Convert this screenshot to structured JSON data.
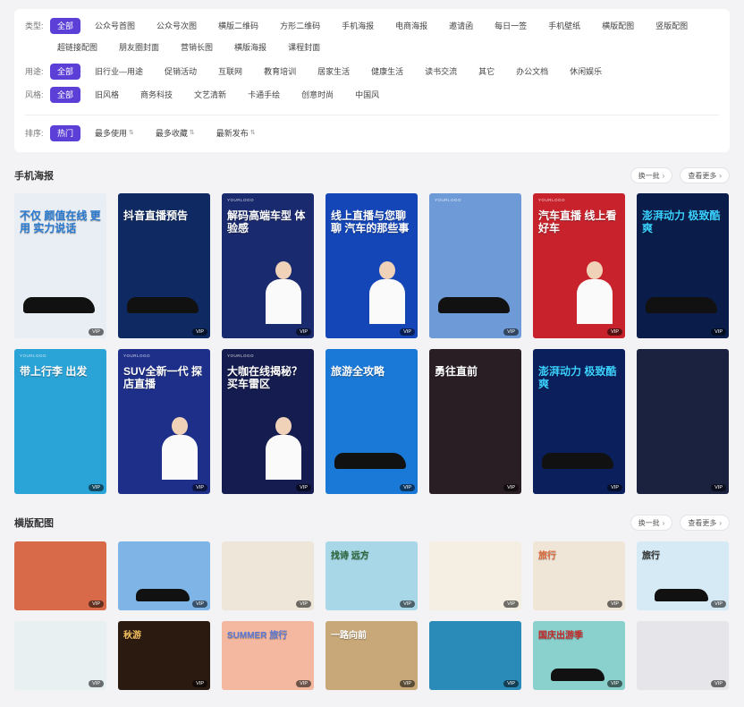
{
  "filters": {
    "type": {
      "label": "类型:",
      "items": [
        "全部",
        "公众号首图",
        "公众号次图",
        "横版二维码",
        "方形二维码",
        "手机海报",
        "电商海报",
        "邀请函",
        "每日一签",
        "手机壁纸",
        "横版配图",
        "竖版配图",
        "超链接配图",
        "朋友圈封面",
        "营销长图",
        "横版海报",
        "课程封面"
      ],
      "active": 0
    },
    "usage": {
      "label": "用途:",
      "items": [
        "全部",
        "旧行业—用途",
        "促销活动",
        "互联网",
        "教育培训",
        "居家生活",
        "健康生活",
        "读书交流",
        "其它",
        "办公文档",
        "休闲娱乐"
      ],
      "active": 0
    },
    "style": {
      "label": "风格:",
      "items": [
        "全部",
        "旧风格",
        "商务科技",
        "文艺清新",
        "卡通手绘",
        "创意时尚",
        "中国风"
      ],
      "active": 0
    },
    "sort": {
      "label": "排序:",
      "items": [
        "热门",
        "最多使用",
        "最多收藏",
        "最新发布"
      ],
      "active": 0,
      "icon": "sort-icon"
    }
  },
  "sections": [
    {
      "title": "手机海报",
      "refresh_label": "换一批",
      "more_label": "查看更多",
      "cards": [
        {
          "headline": "不仅 颜值在线 更用 实力说话",
          "bg": "#e8eef4",
          "text_color": "#2a7bd1",
          "logo": "",
          "shape": "car",
          "vip": "VIP"
        },
        {
          "headline": "抖音直播预告",
          "bg": "#0f2a63",
          "text_color": "#fff",
          "logo": "",
          "shape": "car",
          "vip": "VIP"
        },
        {
          "headline": "解码高端车型 体验感",
          "bg": "#1a2a6e",
          "text_color": "#fff",
          "logo": "YOURLOGO",
          "shape": "person",
          "vip": "VIP"
        },
        {
          "headline": "线上直播与您聊聊 汽车的那些事",
          "bg": "#1546b8",
          "text_color": "#fff",
          "logo": "",
          "shape": "person",
          "vip": "VIP"
        },
        {
          "headline": "",
          "bg": "#6e9bd8",
          "text_color": "#fff",
          "logo": "YOURLOGO",
          "shape": "car",
          "vip": "VIP"
        },
        {
          "headline": "汽车直播 线上看好车",
          "bg": "#c8232c",
          "text_color": "#fff",
          "logo": "YOURLOGO",
          "shape": "person",
          "vip": "VIP"
        },
        {
          "headline": "澎湃动力 极致酷爽",
          "bg": "#0a1c4a",
          "text_color": "#3ad0ff",
          "logo": "",
          "shape": "car",
          "vip": "VIP"
        },
        {
          "headline": "带上行李 出发",
          "bg": "#2aa3d6",
          "text_color": "#fff",
          "logo": "YOURLOGO",
          "shape": "none",
          "vip": "VIP"
        },
        {
          "headline": "SUV全新一代 探店直播",
          "bg": "#1e2f8a",
          "text_color": "#fff",
          "logo": "YOURLOGO",
          "shape": "person",
          "vip": "VIP"
        },
        {
          "headline": "大咖在线揭秘？ 买车雷区",
          "bg": "#151c4f",
          "text_color": "#fff",
          "logo": "YOURLOGO",
          "shape": "person",
          "vip": "VIP"
        },
        {
          "headline": "旅游全攻略",
          "bg": "#1a78d6",
          "text_color": "#fff",
          "logo": "",
          "shape": "car",
          "vip": "VIP"
        },
        {
          "headline": "勇往直前",
          "bg": "#2a1e25",
          "text_color": "#fff",
          "logo": "",
          "shape": "none",
          "vip": "VIP"
        },
        {
          "headline": "澎湃动力 极致酷爽",
          "bg": "#0b1f5c",
          "text_color": "#3ad0ff",
          "logo": "",
          "shape": "car",
          "vip": "VIP"
        },
        {
          "headline": "",
          "bg": "#1a2240",
          "text_color": "#fff",
          "logo": "",
          "shape": "none",
          "vip": "VIP"
        }
      ]
    },
    {
      "title": "横版配图",
      "refresh_label": "换一批",
      "more_label": "查看更多",
      "cards": [
        {
          "headline": "",
          "bg": "#d86a4a",
          "text_color": "#fff",
          "logo": "",
          "shape": "none",
          "vip": "VIP"
        },
        {
          "headline": "",
          "bg": "#7fb4e6",
          "text_color": "#fff",
          "logo": "",
          "shape": "car",
          "vip": "VIP"
        },
        {
          "headline": "",
          "bg": "#efe6da",
          "text_color": "#333",
          "logo": "",
          "shape": "none",
          "vip": "VIP"
        },
        {
          "headline": "找诗 远方",
          "bg": "#a8d8e8",
          "text_color": "#2a6a3a",
          "logo": "",
          "shape": "none",
          "vip": "VIP"
        },
        {
          "headline": "",
          "bg": "#f4efe2",
          "text_color": "#333",
          "logo": "",
          "shape": "none",
          "vip": "VIP"
        },
        {
          "headline": "旅行",
          "bg": "#f0e6d8",
          "text_color": "#e06a3a",
          "logo": "",
          "shape": "none",
          "vip": "VIP"
        },
        {
          "headline": "旅行",
          "bg": "#d6eaf6",
          "text_color": "#333",
          "logo": "",
          "shape": "car",
          "vip": "VIP"
        },
        {
          "headline": "",
          "bg": "#e8f0f2",
          "text_color": "#333",
          "logo": "",
          "shape": "none",
          "vip": "VIP"
        },
        {
          "headline": "秋游",
          "bg": "#2a1a10",
          "text_color": "#f4c060",
          "logo": "",
          "shape": "none",
          "vip": "VIP"
        },
        {
          "headline": "SUMMER 旅行",
          "bg": "#f4b8a0",
          "text_color": "#5a7ad6",
          "logo": "",
          "shape": "none",
          "vip": "VIP"
        },
        {
          "headline": "一路向前",
          "bg": "#c8a878",
          "text_color": "#fff",
          "logo": "",
          "shape": "none",
          "vip": "VIP"
        },
        {
          "headline": "",
          "bg": "#2a8ab8",
          "text_color": "#fff",
          "logo": "",
          "shape": "none",
          "vip": "VIP"
        },
        {
          "headline": "国庆出游季",
          "bg": "#8ad0cc",
          "text_color": "#c82a2a",
          "logo": "",
          "shape": "car",
          "vip": "VIP"
        },
        {
          "headline": "",
          "bg": "#e6e6ea",
          "text_color": "#333",
          "logo": "",
          "shape": "none",
          "vip": "VIP"
        }
      ]
    }
  ]
}
